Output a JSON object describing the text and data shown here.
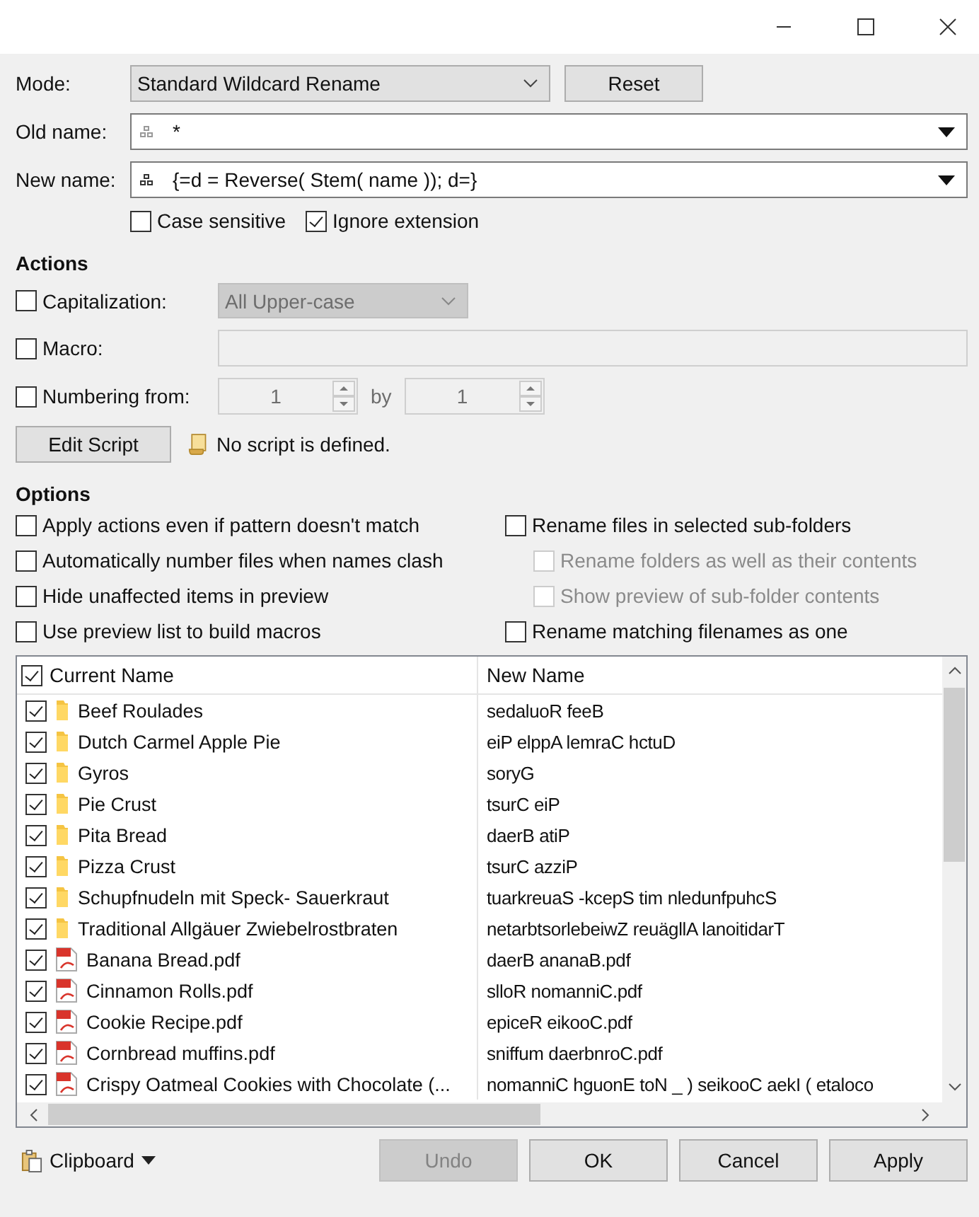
{
  "form": {
    "mode": {
      "label": "Mode:",
      "value": "Standard Wildcard Rename"
    },
    "reset_button": "Reset",
    "old_name": {
      "label": "Old name:",
      "value": "*"
    },
    "new_name": {
      "label": "New name:",
      "value": "{=d = Reverse( Stem( name )); d=}"
    },
    "flags": [
      {
        "label": "Case sensitive",
        "checked": false
      },
      {
        "label": "Ignore extension",
        "checked": true
      }
    ]
  },
  "actions": {
    "heading": "Actions",
    "capitalization": {
      "label": "Capitalization:",
      "checked": false,
      "value": "All Upper-case"
    },
    "macro": {
      "label": "Macro:",
      "checked": false
    },
    "numbering": {
      "label": "Numbering from:",
      "checked": false,
      "from": "1",
      "by_label": "by",
      "by": "1"
    },
    "edit_script_button": "Edit Script",
    "script_status": "No script is defined."
  },
  "options": {
    "heading": "Options",
    "left": [
      {
        "label": "Apply actions even if pattern doesn't match",
        "checked": false,
        "disabled": false
      },
      {
        "label": "Automatically number files when names clash",
        "checked": false,
        "disabled": false
      },
      {
        "label": "Hide unaffected items in preview",
        "checked": false,
        "disabled": false
      },
      {
        "label": "Use preview list to build macros",
        "checked": false,
        "disabled": false
      }
    ],
    "right": [
      {
        "label": "Rename files in selected sub-folders",
        "checked": false,
        "disabled": false
      },
      {
        "label": "Rename folders as well as their contents",
        "checked": false,
        "disabled": true
      },
      {
        "label": "Show preview of sub-folder contents",
        "checked": false,
        "disabled": true
      },
      {
        "label": "Rename matching filenames as one",
        "checked": false,
        "disabled": false
      }
    ]
  },
  "table": {
    "all_checked": true,
    "columns": [
      "Current Name",
      "New Name"
    ],
    "rows": [
      {
        "kind": "folder",
        "checked": true,
        "current": "Beef Roulades",
        "new": "sedaluoR feeB"
      },
      {
        "kind": "folder",
        "checked": true,
        "current": "Dutch Carmel Apple Pie",
        "new": "eiP elppA lemraC hctuD"
      },
      {
        "kind": "folder",
        "checked": true,
        "current": "Gyros",
        "new": "soryG"
      },
      {
        "kind": "folder",
        "checked": true,
        "current": "Pie Crust",
        "new": "tsurC eiP"
      },
      {
        "kind": "folder",
        "checked": true,
        "current": "Pita Bread",
        "new": "daerB atiP"
      },
      {
        "kind": "folder",
        "checked": true,
        "current": "Pizza Crust",
        "new": "tsurC azziP"
      },
      {
        "kind": "folder",
        "checked": true,
        "current": "Schupfnudeln mit Speck- Sauerkraut",
        "new": "tuarkreuaS -kcepS tim nledunfpuhcS"
      },
      {
        "kind": "folder",
        "checked": true,
        "current": "Traditional Allgäuer Zwiebelrostbraten",
        "new": "netarbtsorlebeiwZ reuägllA lanoitidarT"
      },
      {
        "kind": "pdf",
        "checked": true,
        "current": "Banana Bread.pdf",
        "new": "daerB ananaB.pdf"
      },
      {
        "kind": "pdf",
        "checked": true,
        "current": "Cinnamon Rolls.pdf",
        "new": "slloR nomanniC.pdf"
      },
      {
        "kind": "pdf",
        "checked": true,
        "current": "Cookie Recipe.pdf",
        "new": "epiceR eikooC.pdf"
      },
      {
        "kind": "pdf",
        "checked": true,
        "current": "Cornbread muffins.pdf",
        "new": "sniffum daerbnroC.pdf"
      },
      {
        "kind": "pdf",
        "checked": true,
        "current": "Crispy Oatmeal Cookies with Chocolate (...",
        "new": "nomanniC hguonE toN _ ) seikooC aekI ( etaloco"
      }
    ]
  },
  "footer": {
    "clipboard": "Clipboard",
    "buttons": [
      {
        "label": "Undo",
        "disabled": true
      },
      {
        "label": "OK",
        "disabled": false
      },
      {
        "label": "Cancel",
        "disabled": false
      },
      {
        "label": "Apply",
        "disabled": false
      }
    ]
  }
}
